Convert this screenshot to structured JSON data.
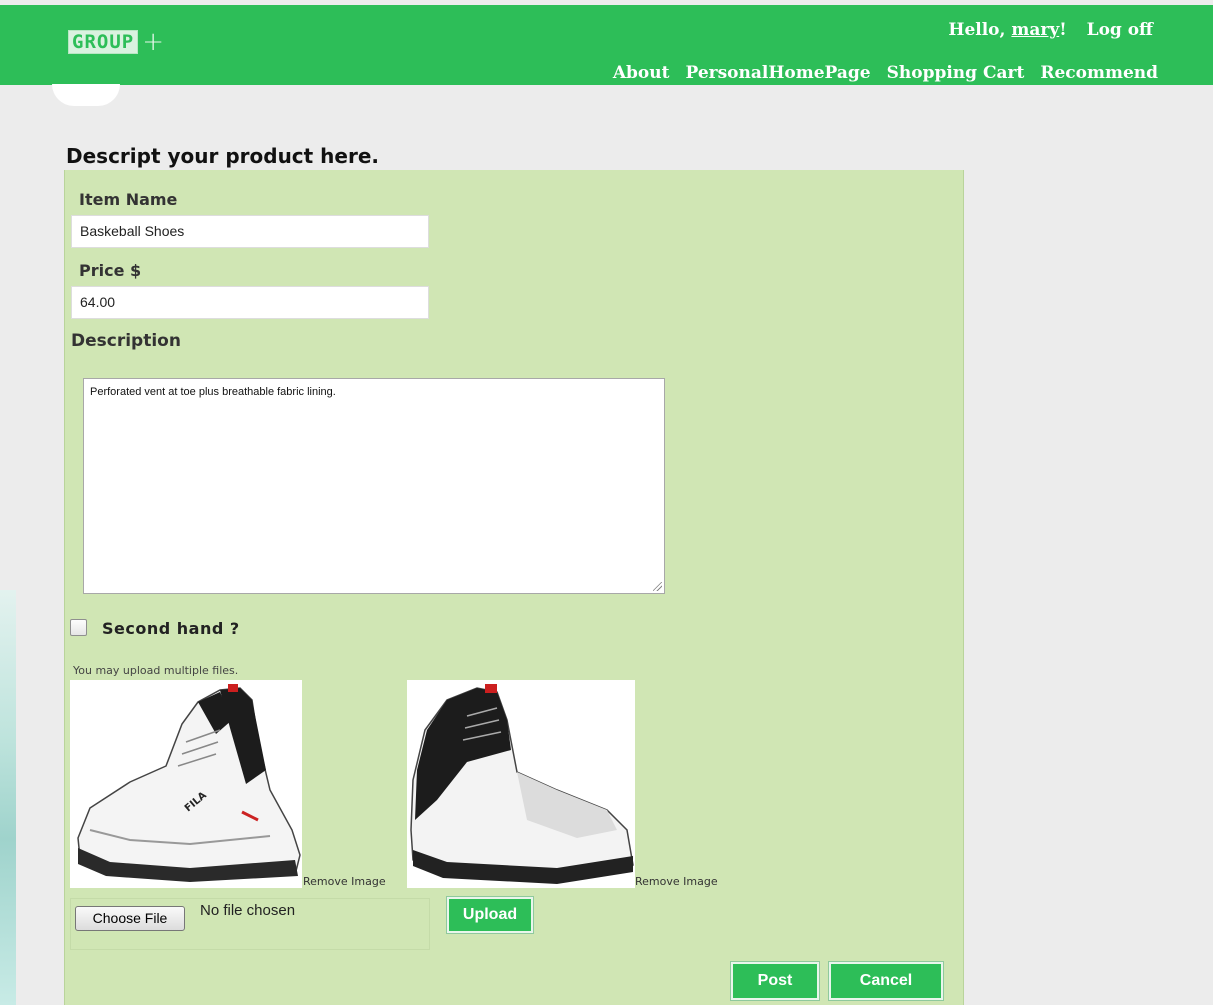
{
  "header": {
    "logo_text": "GROUP",
    "logo_plus": "+",
    "greeting_prefix": "Hello,",
    "username": "mary",
    "greeting_suffix": "!",
    "logoff_label": "Log off",
    "nav": [
      "About",
      "PersonalHomePage",
      "Shopping Cart",
      "Recommend"
    ]
  },
  "page": {
    "title": "Descript your product here."
  },
  "form": {
    "item_name_label": "Item Name",
    "item_name_value": "Baskeball Shoes",
    "price_label": "Price $",
    "price_value": "64.00",
    "description_label": "Description",
    "description_value": "Perforated vent at toe plus breathable fabric lining.",
    "second_hand_label": "Second hand ?",
    "second_hand_checked": false,
    "upload_hint": "You may upload multiple files.",
    "images": [
      {
        "alt": "shoe-image-1",
        "remove_label": "Remove Image"
      },
      {
        "alt": "shoe-image-2",
        "remove_label": "Remove Image"
      }
    ],
    "choose_file_label": "Choose File",
    "no_file_text": "No file chosen",
    "upload_label": "Upload",
    "post_label": "Post",
    "cancel_label": "Cancel"
  },
  "colors": {
    "header_green": "#2dbe58",
    "panel_green": "#d0e6b4",
    "page_bg": "#ececec"
  }
}
